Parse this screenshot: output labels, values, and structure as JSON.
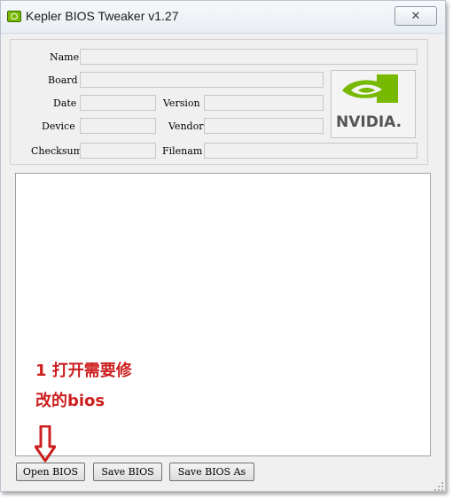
{
  "window": {
    "title": "Kepler BIOS Tweaker v1.27",
    "close_label": "✕"
  },
  "fields": {
    "name_label": "Name",
    "board_label": "Board",
    "date_label": "Date",
    "version_label": "Version",
    "device_label": "Device",
    "vendor_label": "Vendor",
    "checksum_label": "Checksum",
    "filename_label": "Filenam"
  },
  "logo": {
    "text": "NVIDIA.",
    "icon": "nvidia-eye-icon",
    "brand_color": "#76b900"
  },
  "buttons": {
    "open_bios": "Open BIOS",
    "save_bios": "Save BIOS",
    "save_bios_as": "Save BIOS As"
  },
  "annotation": {
    "line1": "1 打开需要修",
    "line2": "改的bios",
    "color": "#cc1f1f"
  }
}
